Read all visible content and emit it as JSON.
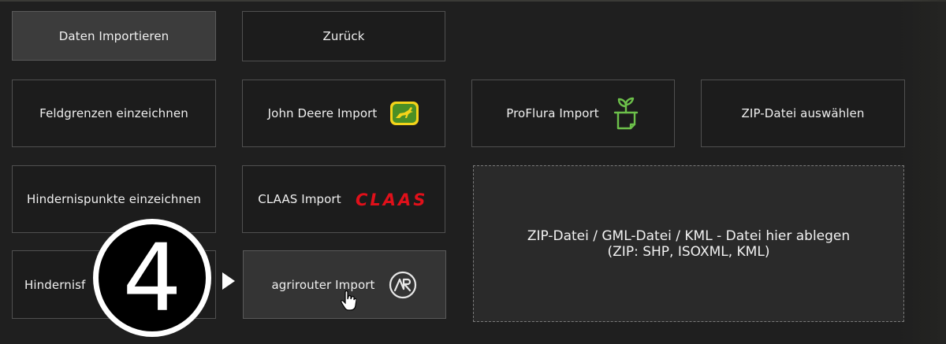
{
  "top_buttons": {
    "import_data": "Daten Importieren",
    "back": "Zurück"
  },
  "actions": {
    "draw_field_boundaries": "Feldgrenzen einzeichnen",
    "draw_obstacle_points": "Hindernispunkte einzeichnen",
    "draw_obstacle_areas_partial": "Hindernisf"
  },
  "imports": {
    "john_deere": "John Deere Import",
    "claas": "CLAAS Import",
    "claas_logo": "CLAAS",
    "agrirouter": "agrirouter Import",
    "proflura": "ProFlura Import",
    "zip_select": "ZIP-Datei auswählen"
  },
  "dropzone": {
    "line1": "ZIP-Datei / GML-Datei / KML - Datei hier ablegen",
    "line2": "(ZIP: SHP, ISOXML, KML)"
  },
  "overlay": {
    "step_number": "4"
  },
  "icons": {
    "john_deere": "john-deere-deer-icon",
    "claas": "claas-logo",
    "agrirouter": "agrirouter-ar-icon",
    "proflura": "plant-document-icon",
    "cursor": "hand-pointer-cursor"
  },
  "colors": {
    "background": "#1f1f1f",
    "button_border": "#505050",
    "active_button": "#3c3c3c",
    "john_deere_green": "#5aa02c",
    "john_deere_yellow": "#f4d31a",
    "claas_red": "#e0101a",
    "proflura_green": "#6cc04a"
  }
}
